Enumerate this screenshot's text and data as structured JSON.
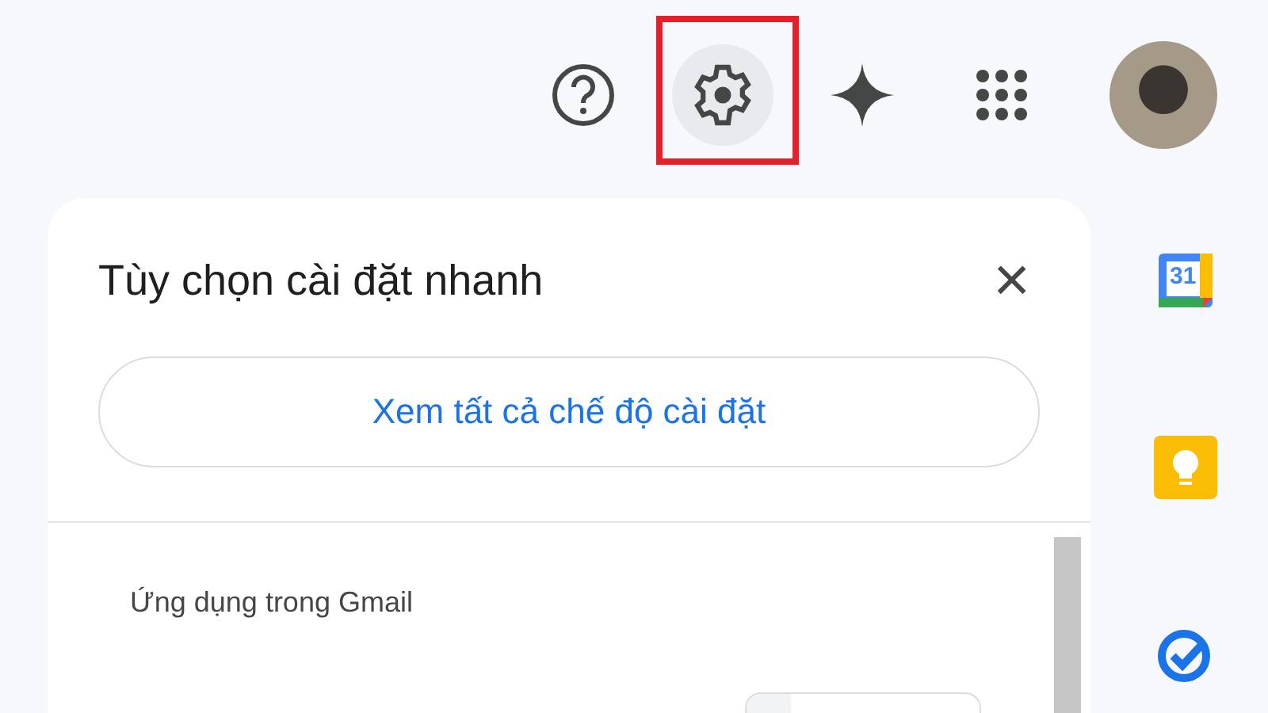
{
  "top_bar": {
    "settings_selected": true
  },
  "quick_settings": {
    "title": "Tùy chọn cài đặt nhanh",
    "close": "×",
    "see_all_button": "Xem tất cả chế độ cài đặt",
    "section_heading": "Ứng dụng trong Gmail"
  },
  "side_panel": {
    "calendar_day": "31"
  }
}
